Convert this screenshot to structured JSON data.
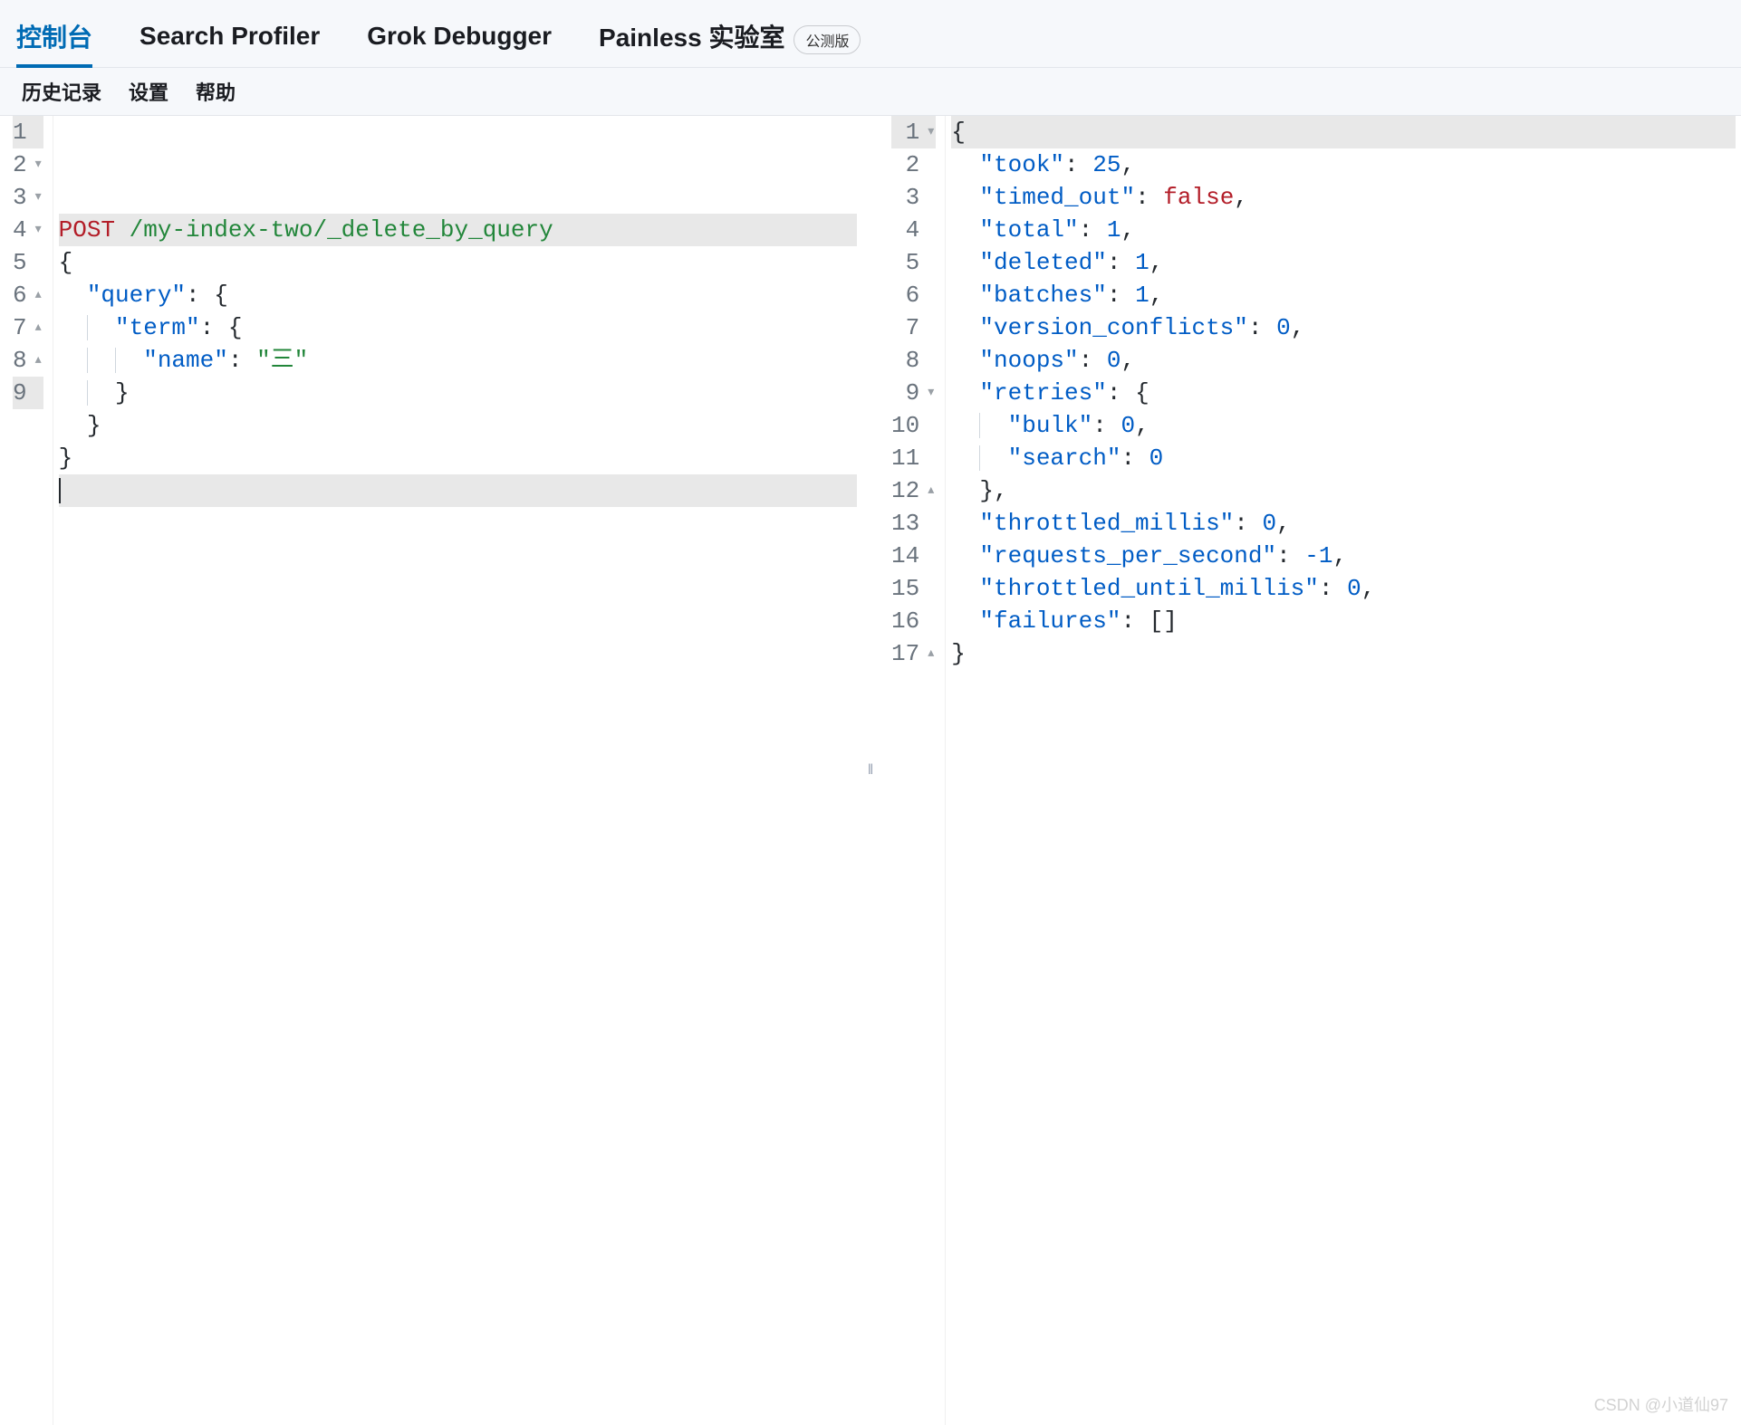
{
  "tabs": [
    {
      "label": "控制台",
      "active": true
    },
    {
      "label": "Search Profiler"
    },
    {
      "label": "Grok Debugger"
    },
    {
      "label": "Painless 实验室",
      "badge": "公测版"
    }
  ],
  "subtabs": [
    "历史记录",
    "设置",
    "帮助"
  ],
  "request": {
    "method": "POST",
    "path": "/my-index-two/_delete_by_query",
    "body_lines": [
      {
        "n": 2,
        "fold": "▾",
        "indent": 0,
        "tokens": [
          {
            "t": "{",
            "cls": "hl-plain"
          }
        ]
      },
      {
        "n": 3,
        "fold": "▾",
        "indent": 1,
        "tokens": [
          {
            "t": "\"query\"",
            "cls": "hl-key"
          },
          {
            "t": ": {",
            "cls": "hl-plain"
          }
        ]
      },
      {
        "n": 4,
        "fold": "▾",
        "indent": 2,
        "tokens": [
          {
            "t": "\"term\"",
            "cls": "hl-key"
          },
          {
            "t": ": {",
            "cls": "hl-plain"
          }
        ]
      },
      {
        "n": 5,
        "fold": "",
        "indent": 3,
        "tokens": [
          {
            "t": "\"name\"",
            "cls": "hl-key"
          },
          {
            "t": ": ",
            "cls": "hl-plain"
          },
          {
            "t": "\"三\"",
            "cls": "hl-string"
          }
        ]
      },
      {
        "n": 6,
        "fold": "▴",
        "indent": 2,
        "tokens": [
          {
            "t": "}",
            "cls": "hl-plain"
          }
        ]
      },
      {
        "n": 7,
        "fold": "▴",
        "indent": 1,
        "tokens": [
          {
            "t": "}",
            "cls": "hl-plain"
          }
        ]
      },
      {
        "n": 8,
        "fold": "▴",
        "indent": 0,
        "tokens": [
          {
            "t": "}",
            "cls": "hl-plain"
          }
        ]
      },
      {
        "n": 9,
        "fold": "",
        "indent": 0,
        "tokens": [],
        "cursor": true,
        "active": true
      }
    ]
  },
  "response_lines": [
    {
      "n": 1,
      "fold": "▾",
      "indent": 0,
      "active": true,
      "tokens": [
        {
          "t": "{",
          "cls": "hl-plain"
        }
      ]
    },
    {
      "n": 2,
      "fold": "",
      "indent": 1,
      "tokens": [
        {
          "t": "\"took\"",
          "cls": "hl-key"
        },
        {
          "t": ": ",
          "cls": "hl-plain"
        },
        {
          "t": "25",
          "cls": "hl-number"
        },
        {
          "t": ",",
          "cls": "hl-plain"
        }
      ]
    },
    {
      "n": 3,
      "fold": "",
      "indent": 1,
      "tokens": [
        {
          "t": "\"timed_out\"",
          "cls": "hl-key"
        },
        {
          "t": ": ",
          "cls": "hl-plain"
        },
        {
          "t": "false",
          "cls": "hl-bool"
        },
        {
          "t": ",",
          "cls": "hl-plain"
        }
      ]
    },
    {
      "n": 4,
      "fold": "",
      "indent": 1,
      "tokens": [
        {
          "t": "\"total\"",
          "cls": "hl-key"
        },
        {
          "t": ": ",
          "cls": "hl-plain"
        },
        {
          "t": "1",
          "cls": "hl-number"
        },
        {
          "t": ",",
          "cls": "hl-plain"
        }
      ]
    },
    {
      "n": 5,
      "fold": "",
      "indent": 1,
      "tokens": [
        {
          "t": "\"deleted\"",
          "cls": "hl-key"
        },
        {
          "t": ": ",
          "cls": "hl-plain"
        },
        {
          "t": "1",
          "cls": "hl-number"
        },
        {
          "t": ",",
          "cls": "hl-plain"
        }
      ]
    },
    {
      "n": 6,
      "fold": "",
      "indent": 1,
      "tokens": [
        {
          "t": "\"batches\"",
          "cls": "hl-key"
        },
        {
          "t": ": ",
          "cls": "hl-plain"
        },
        {
          "t": "1",
          "cls": "hl-number"
        },
        {
          "t": ",",
          "cls": "hl-plain"
        }
      ]
    },
    {
      "n": 7,
      "fold": "",
      "indent": 1,
      "tokens": [
        {
          "t": "\"version_conflicts\"",
          "cls": "hl-key"
        },
        {
          "t": ": ",
          "cls": "hl-plain"
        },
        {
          "t": "0",
          "cls": "hl-number"
        },
        {
          "t": ",",
          "cls": "hl-plain"
        }
      ]
    },
    {
      "n": 8,
      "fold": "",
      "indent": 1,
      "tokens": [
        {
          "t": "\"noops\"",
          "cls": "hl-key"
        },
        {
          "t": ": ",
          "cls": "hl-plain"
        },
        {
          "t": "0",
          "cls": "hl-number"
        },
        {
          "t": ",",
          "cls": "hl-plain"
        }
      ]
    },
    {
      "n": 9,
      "fold": "▾",
      "indent": 1,
      "tokens": [
        {
          "t": "\"retries\"",
          "cls": "hl-key"
        },
        {
          "t": ": {",
          "cls": "hl-plain"
        }
      ]
    },
    {
      "n": 10,
      "fold": "",
      "indent": 2,
      "tokens": [
        {
          "t": "\"bulk\"",
          "cls": "hl-key"
        },
        {
          "t": ": ",
          "cls": "hl-plain"
        },
        {
          "t": "0",
          "cls": "hl-number"
        },
        {
          "t": ",",
          "cls": "hl-plain"
        }
      ]
    },
    {
      "n": 11,
      "fold": "",
      "indent": 2,
      "tokens": [
        {
          "t": "\"search\"",
          "cls": "hl-key"
        },
        {
          "t": ": ",
          "cls": "hl-plain"
        },
        {
          "t": "0",
          "cls": "hl-number"
        }
      ]
    },
    {
      "n": 12,
      "fold": "▴",
      "indent": 1,
      "tokens": [
        {
          "t": "},",
          "cls": "hl-plain"
        }
      ]
    },
    {
      "n": 13,
      "fold": "",
      "indent": 1,
      "tokens": [
        {
          "t": "\"throttled_millis\"",
          "cls": "hl-key"
        },
        {
          "t": ": ",
          "cls": "hl-plain"
        },
        {
          "t": "0",
          "cls": "hl-number"
        },
        {
          "t": ",",
          "cls": "hl-plain"
        }
      ]
    },
    {
      "n": 14,
      "fold": "",
      "indent": 1,
      "tokens": [
        {
          "t": "\"requests_per_second\"",
          "cls": "hl-key"
        },
        {
          "t": ": ",
          "cls": "hl-plain"
        },
        {
          "t": "-1",
          "cls": "hl-number"
        },
        {
          "t": ",",
          "cls": "hl-plain"
        }
      ]
    },
    {
      "n": 15,
      "fold": "",
      "indent": 1,
      "tokens": [
        {
          "t": "\"throttled_until_millis\"",
          "cls": "hl-key"
        },
        {
          "t": ": ",
          "cls": "hl-plain"
        },
        {
          "t": "0",
          "cls": "hl-number"
        },
        {
          "t": ",",
          "cls": "hl-plain"
        }
      ]
    },
    {
      "n": 16,
      "fold": "",
      "indent": 1,
      "tokens": [
        {
          "t": "\"failures\"",
          "cls": "hl-key"
        },
        {
          "t": ": []",
          "cls": "hl-plain"
        }
      ]
    },
    {
      "n": 17,
      "fold": "▴",
      "indent": 0,
      "tokens": [
        {
          "t": "}",
          "cls": "hl-plain"
        }
      ]
    }
  ],
  "watermark": "CSDN @小道仙97",
  "divider_glyph": "‖"
}
